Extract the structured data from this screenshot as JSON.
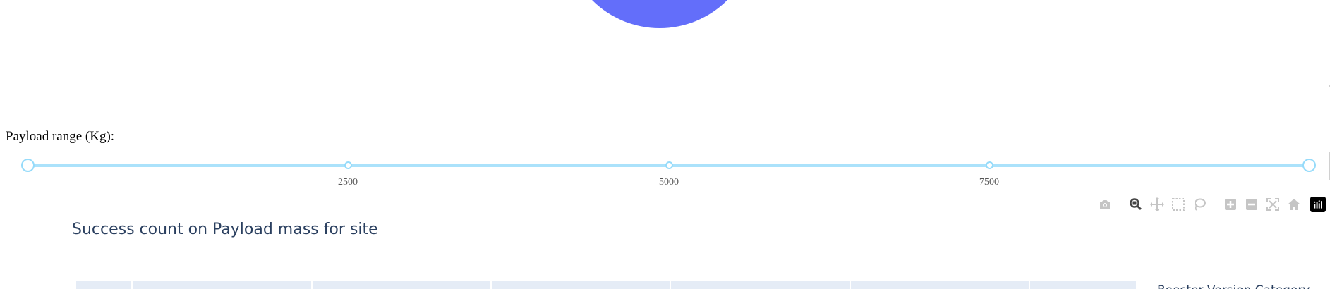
{
  "pie": {
    "color": "#636efa"
  },
  "slider": {
    "label": "Payload range (Kg):",
    "rail_color": "#abe2fb",
    "handle_color": "#96dbfa",
    "min": 0,
    "max": 10000,
    "value": [
      0,
      10000
    ],
    "marks": [
      "2500",
      "5000",
      "7500"
    ]
  },
  "modebar": {
    "buttons": [
      {
        "name": "camera-icon",
        "title": "Download plot as a png",
        "active": false
      },
      {
        "name": "zoom-icon",
        "title": "Zoom",
        "active": true
      },
      {
        "name": "pan-icon",
        "title": "Pan",
        "active": false
      },
      {
        "name": "box-select-icon",
        "title": "Box Select",
        "active": false
      },
      {
        "name": "lasso-select-icon",
        "title": "Lasso Select",
        "active": false
      },
      {
        "name": "zoom-in-icon",
        "title": "Zoom in",
        "active": false
      },
      {
        "name": "zoom-out-icon",
        "title": "Zoom out",
        "active": false
      },
      {
        "name": "autoscale-icon",
        "title": "Autoscale",
        "active": false
      },
      {
        "name": "home-icon",
        "title": "Reset axes",
        "active": false
      },
      {
        "name": "plotly-logo-icon",
        "title": "Produced with Plotly",
        "active": false
      }
    ]
  },
  "graph": {
    "title": "Success count on Payload mass for site",
    "plot_bg_color": "#e5ecf6",
    "legend_title": "Booster Version Category"
  }
}
